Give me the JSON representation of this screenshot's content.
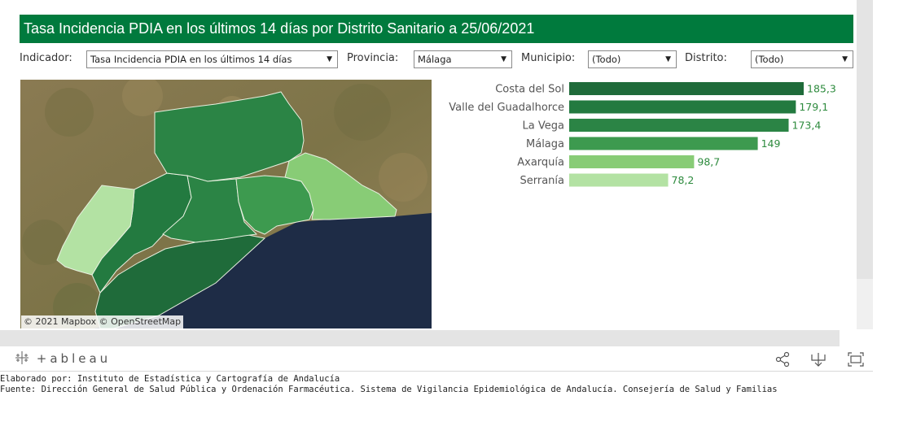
{
  "title": "Tasa Incidencia PDIA en los últimos 14 días por Distrito Sanitario a 25/06/2021",
  "filters": {
    "indicador": {
      "label": "Indicador:",
      "value": "Tasa Incidencia PDIA en los últimos 14 días"
    },
    "provincia": {
      "label": "Provincia:",
      "value": "Málaga"
    },
    "municipio": {
      "label": "Municipio:",
      "value": "(Todo)"
    },
    "distrito": {
      "label": "Distrito:",
      "value": "(Todo)"
    }
  },
  "map": {
    "attribution": "© 2021 Mapbox  © OpenStreetMap",
    "sea_color": "#1e2c46",
    "land_color": "#8a7a52"
  },
  "chart_data": {
    "type": "bar",
    "orientation": "horizontal",
    "categories": [
      "Costa del Sol",
      "Valle del Guadalhorce",
      "La Vega",
      "Málaga",
      "Axarquía",
      "Serranía"
    ],
    "values": [
      185.3,
      179.1,
      173.4,
      149,
      98.7,
      78.2
    ],
    "labels": [
      "185,3",
      "179,1",
      "173,4",
      "149",
      "98,7",
      "78,2"
    ],
    "colors": [
      "#1f6b3a",
      "#237a40",
      "#2b8445",
      "#3d9a4f",
      "#88cc76",
      "#b3e2a3"
    ],
    "label_color": "#2e8b3e",
    "xlim": [
      0,
      185.3
    ]
  },
  "toolbar": {
    "logo_text": "+ableau",
    "icons": [
      "share-icon",
      "download-icon",
      "fullscreen-icon"
    ]
  },
  "footer": {
    "line1": "Elaborado por: Instituto de Estadística y Cartografía de Andalucía",
    "line2": "Fuente: Dirección General de Salud Pública y Ordenación Farmacéutica. Sistema de Vigilancia Epidemiológica de Andalucía. Consejería de Salud y Familias"
  }
}
